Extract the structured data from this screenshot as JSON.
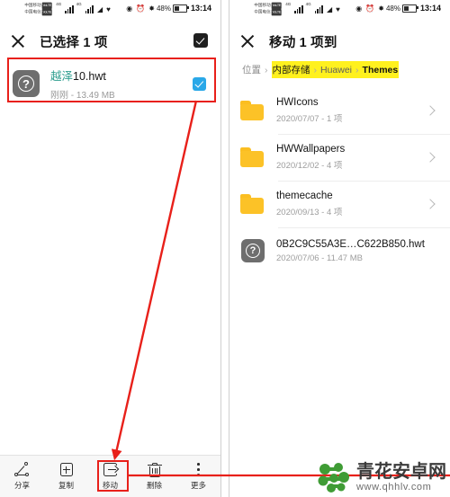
{
  "status_bar": {
    "carrier_primary": "中国移动",
    "carrier_secondary": "中国电信",
    "sim_badge": "VoLTE",
    "net_type_1": "4G",
    "net_type_2": "4G",
    "wifi_icon": "wifi-icon",
    "vpn_icon": "vpn-icon",
    "rotation_icon": "rotation-lock-icon",
    "alarm_icon": "alarm-icon",
    "bluetooth_icon": "bluetooth-icon",
    "battery_percent": "48%",
    "clock": "13:14"
  },
  "left_screen": {
    "appbar": {
      "close_icon": "close-icon",
      "title": "已选择 1 项",
      "select_all_icon": "select-all-checkbox"
    },
    "file": {
      "thumb_icon": "unknown-file-icon",
      "name_highlight": "越泽",
      "name_rest": "10.hwt",
      "subtitle": "刚刚 - 13.49 MB",
      "checked": true
    },
    "toolbar": [
      {
        "icon": "share-icon",
        "label": "分享"
      },
      {
        "icon": "copy-icon",
        "label": "复制"
      },
      {
        "icon": "move-icon",
        "label": "移动"
      },
      {
        "icon": "delete-icon",
        "label": "删除"
      },
      {
        "icon": "more-icon",
        "label": "更多"
      }
    ]
  },
  "right_screen": {
    "appbar": {
      "close_icon": "close-icon",
      "title": "移动 1 项到"
    },
    "breadcrumb": {
      "prefix": "位置",
      "separator": "›",
      "segments": [
        {
          "label": "内部存储",
          "highlighted": true,
          "bold": false
        },
        {
          "label": "Huawei",
          "highlighted": true,
          "bold": false
        },
        {
          "label": "Themes",
          "highlighted": true,
          "bold": true
        }
      ]
    },
    "items": [
      {
        "icon": "folder-icon",
        "title": "HWIcons",
        "subtitle": "2020/07/07 - 1 项",
        "chevron": true
      },
      {
        "icon": "folder-icon",
        "title": "HWWallpapers",
        "subtitle": "2020/12/02 - 4 项",
        "chevron": true
      },
      {
        "icon": "folder-icon",
        "title": "themecache",
        "subtitle": "2020/09/13 - 4 项",
        "chevron": true
      },
      {
        "icon": "unknown-file-icon",
        "title": "0B2C9C55A3E…C622B850.hwt",
        "subtitle": "2020/07/06 - 11.47 MB",
        "chevron": false
      }
    ]
  },
  "annotations": {
    "color": "#e8201a",
    "file_box": "red-highlight-box-on-selected-file",
    "move_box": "red-highlight-box-on-move-button",
    "arrow": "red-arrow-from-file-to-move-button",
    "connector": "red-line-from-move-button-to-right-panel"
  },
  "watermark": {
    "site_cn": "青花安卓网",
    "site_url": "www.qhhlv.com",
    "logo_color": "#3f9c35"
  }
}
